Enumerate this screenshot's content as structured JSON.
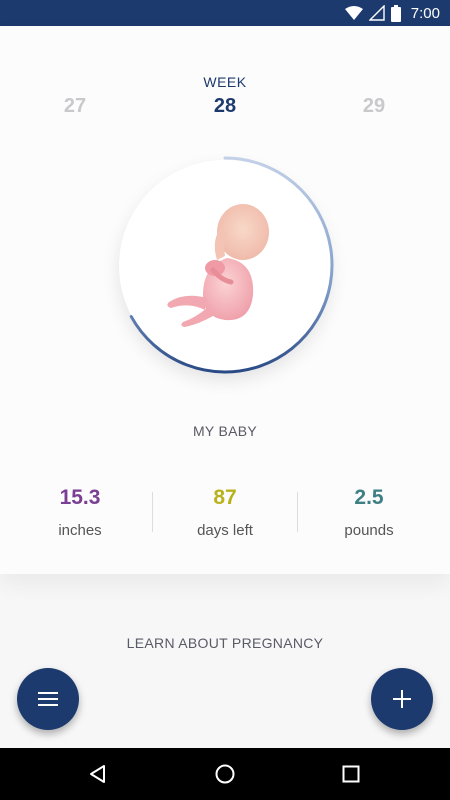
{
  "status_bar": {
    "time": "7:00",
    "icons": [
      "wifi-icon",
      "signal-icon",
      "battery-icon"
    ]
  },
  "week": {
    "label": "WEEK",
    "prev": "27",
    "current": "28",
    "next": "29",
    "progress": 0.67
  },
  "baby": {
    "section_label": "MY BABY"
  },
  "stats": [
    {
      "value": "15.3",
      "label": "inches",
      "color": "#7a3f93"
    },
    {
      "value": "87",
      "label": "days left",
      "color": "#b8b21c"
    },
    {
      "value": "2.5",
      "label": "pounds",
      "color": "#3e7f84"
    }
  ],
  "learn": {
    "label": "LEARN ABOUT PREGNANCY"
  },
  "fabs": {
    "menu_icon": "menu-icon",
    "add_icon": "plus-icon"
  },
  "colors": {
    "primary": "#1d3a6e",
    "ring_light": "#b7c7e3"
  }
}
